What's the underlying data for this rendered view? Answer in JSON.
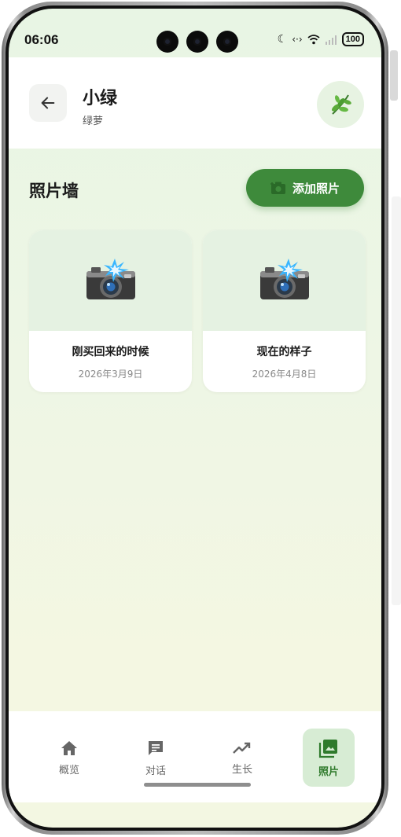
{
  "status_bar": {
    "time": "06:06",
    "battery": "100"
  },
  "header": {
    "title": "小绿",
    "subtitle": "绿萝"
  },
  "section": {
    "title": "照片墙",
    "add_button_label": "添加照片"
  },
  "photos": [
    {
      "caption": "刚买回来的时候",
      "date": "2026年3月9日"
    },
    {
      "caption": "现在的样子",
      "date": "2026年4月8日"
    }
  ],
  "bottom_nav": [
    {
      "label": "概览",
      "icon": "home-icon"
    },
    {
      "label": "对话",
      "icon": "chat-icon"
    },
    {
      "label": "生长",
      "icon": "trending-up-icon"
    },
    {
      "label": "照片",
      "icon": "photo-library-icon",
      "active": true
    }
  ],
  "colors": {
    "accent": "#3e8a3b",
    "active_tab_bg": "#d7ecd4"
  }
}
